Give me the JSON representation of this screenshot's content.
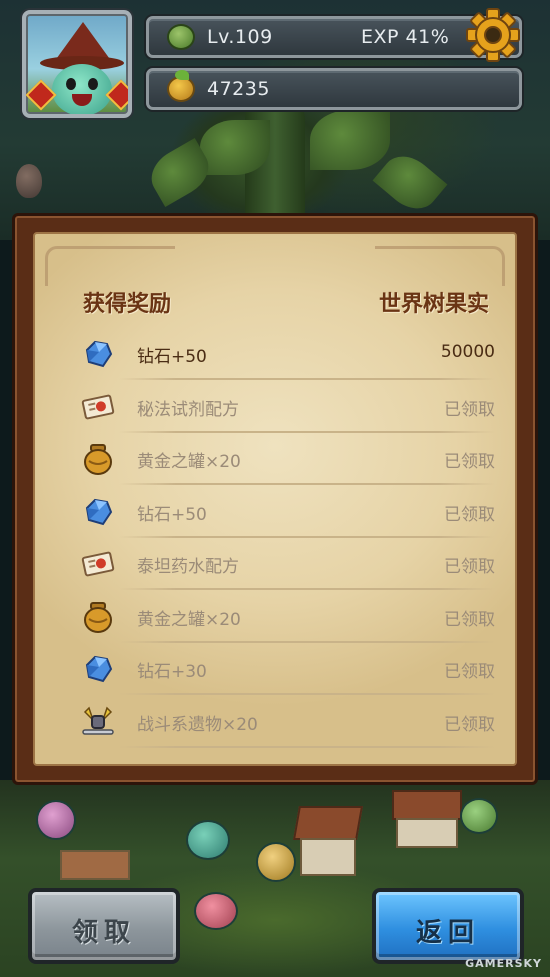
{
  "hud": {
    "level": "Lv.109",
    "exp": "EXP 41%",
    "currency": "47235"
  },
  "panel": {
    "title_left": "获得奖励",
    "title_right": "世界树果实",
    "rows": [
      {
        "icon": "diamond-icon",
        "name": "钻石+50",
        "status": "50000",
        "active": true
      },
      {
        "icon": "recipe-scroll-icon",
        "name": "秘法试剂配方",
        "status": "已领取",
        "active": false
      },
      {
        "icon": "gold-jar-icon",
        "name": "黄金之罐×20",
        "status": "已领取",
        "active": false
      },
      {
        "icon": "diamond-icon",
        "name": "钻石+50",
        "status": "已领取",
        "active": false
      },
      {
        "icon": "recipe-scroll-icon",
        "name": "泰坦药水配方",
        "status": "已领取",
        "active": false
      },
      {
        "icon": "gold-jar-icon",
        "name": "黄金之罐×20",
        "status": "已领取",
        "active": false
      },
      {
        "icon": "diamond-icon",
        "name": "钻石+30",
        "status": "已领取",
        "active": false
      },
      {
        "icon": "battle-relic-icon",
        "name": "战斗系遗物×20",
        "status": "已领取",
        "active": false
      }
    ]
  },
  "buttons": {
    "claim": "领取",
    "back": "返回"
  },
  "watermark": "GAMERSKY",
  "colors": {
    "panel_frame": "#5a2d16",
    "parchment": "#e6d3a6",
    "claim_button": "#8d969c",
    "back_button": "#2f8fe0"
  }
}
